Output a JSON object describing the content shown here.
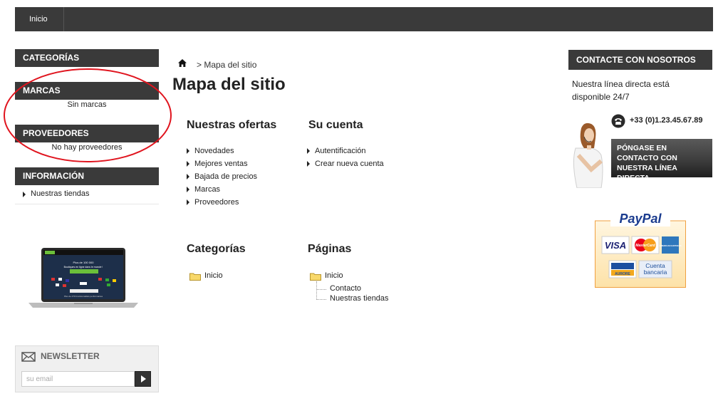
{
  "topbar": {
    "home_label": "Inicio"
  },
  "left": {
    "categories_title": "CATEGORÍAS",
    "brands_title": "MARCAS",
    "brands_empty": "Sin marcas",
    "suppliers_title": "PROVEEDORES",
    "suppliers_empty": "No hay proveedores",
    "info_title": "INFORMACIÓN",
    "info_items": [
      "Nuestras tiendas"
    ],
    "laptop_banner": {
      "headline_1": "Plus de 100 000",
      "headline_2": "Boutiques en ligne dans le monde !",
      "tagline": "Plus de 270 fonctionnalités performantes"
    }
  },
  "newsletter": {
    "title": "NEWSLETTER",
    "placeholder": "su email",
    "submit_icon": "play-icon"
  },
  "breadcrumb": {
    "separator_text": ">  Mapa del sitio",
    "home_icon": "home-icon"
  },
  "main": {
    "title": "Mapa del sitio",
    "sections": {
      "offers": {
        "title": "Nuestras ofertas",
        "links": [
          "Novedades",
          "Mejores ventas",
          "Bajada de precios",
          "Marcas",
          "Proveedores"
        ]
      },
      "account": {
        "title": "Su cuenta",
        "links": [
          "Autentificación",
          "Crear nueva cuenta"
        ]
      },
      "categories": {
        "title": "Categorías",
        "root": "Inicio"
      },
      "pages": {
        "title": "Páginas",
        "root": "Inicio",
        "children": [
          "Contacto",
          "Nuestras tiendas"
        ]
      }
    }
  },
  "contact": {
    "title": "CONTACTE CON NOSOTROS",
    "text": "Nuestra línea directa está disponible 24/7",
    "phone": "+33 (0)1.23.45.67.89",
    "button": "PÓNGASE EN CONTACTO CON NUESTRA LÍNEA DIRECTA"
  },
  "payment": {
    "paypal": "PayPal",
    "visa": "VISA",
    "mastercard": "MasterCard",
    "amex": "AMERICAN EXPRESS",
    "aurora": "AURORE",
    "bank": "Cuenta bancaria"
  },
  "colors": {
    "dark_bar": "#3a3a3a",
    "annotation_red": "#e0141e",
    "paypal_navy": "#1b3c8f",
    "paypal_sky": "#2ba6de",
    "payment_border": "#f0a040"
  }
}
